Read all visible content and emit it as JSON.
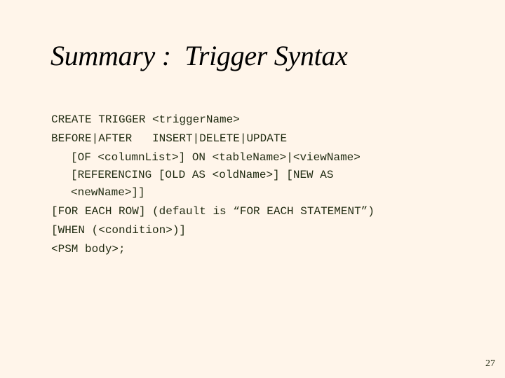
{
  "slide": {
    "title": "Summary :  Trigger Syntax",
    "code_lines": [
      "CREATE TRIGGER <triggerName>",
      "BEFORE|AFTER   INSERT|DELETE|UPDATE",
      "[OF <columnList>] ON <tableName>|<viewName>",
      "[REFERENCING [OLD AS <oldName>] [NEW AS",
      "<newName>]]",
      "[FOR EACH ROW] (default is “FOR EACH STATEMENT”)",
      "[WHEN (<condition>)]",
      "<PSM body>;"
    ],
    "page_number": "27"
  },
  "colors": {
    "background": "#fff5ea",
    "text": "#1f2a10",
    "title": "#000000"
  }
}
